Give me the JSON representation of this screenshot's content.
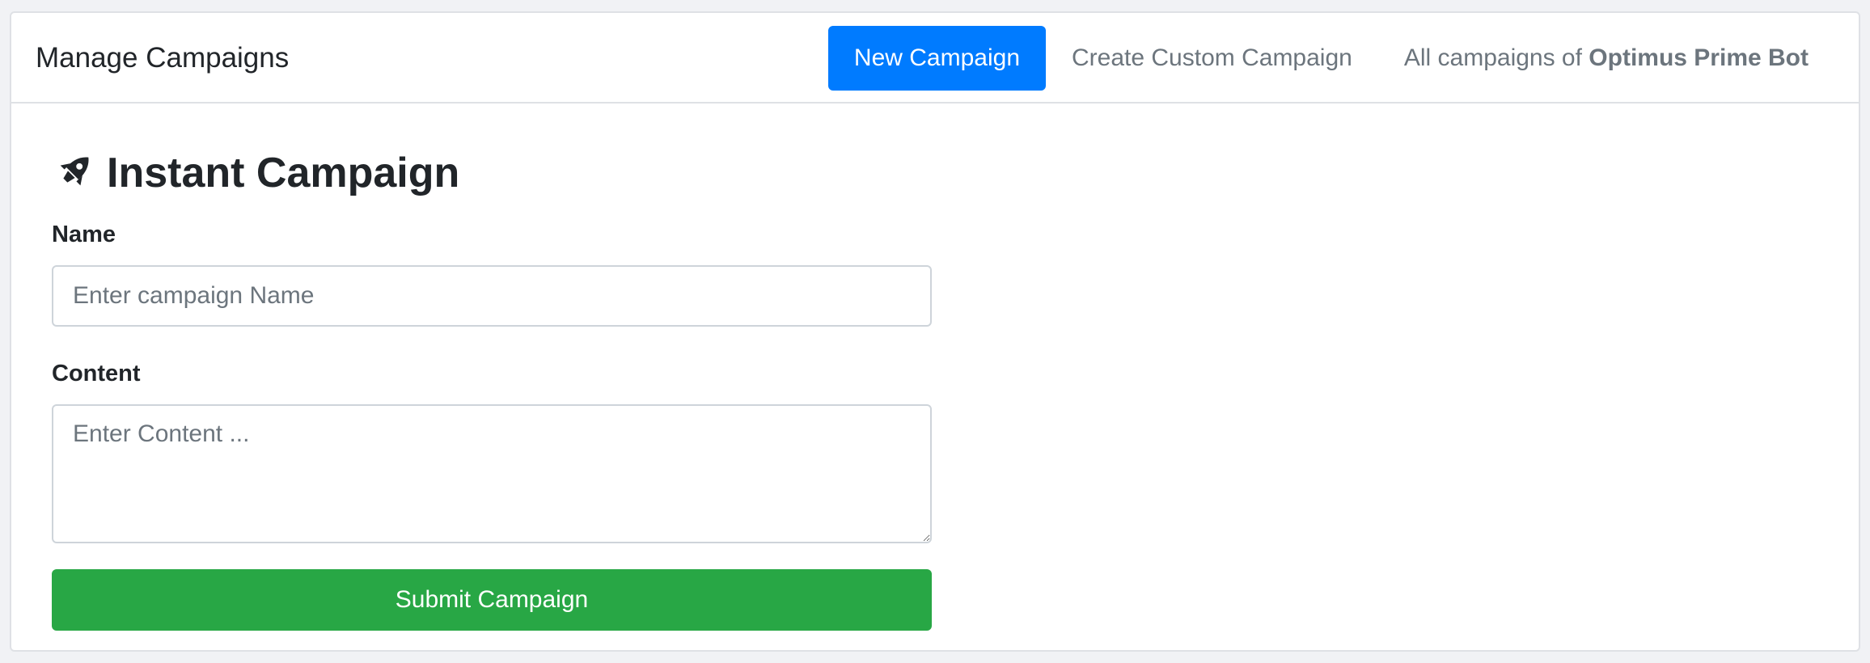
{
  "header": {
    "title": "Manage Campaigns",
    "nav": {
      "new_campaign": "New Campaign",
      "create_custom": "Create Custom Campaign",
      "all_campaigns_prefix": "All campaigns of ",
      "bot_name": "Optimus Prime Bot"
    }
  },
  "form": {
    "title": "Instant Campaign",
    "title_icon": "rocket-icon",
    "name_label": "Name",
    "name_placeholder": "Enter campaign Name",
    "name_value": "",
    "content_label": "Content",
    "content_placeholder": "Enter Content ...",
    "content_value": "",
    "submit_label": "Submit Campaign"
  },
  "colors": {
    "primary": "#007bff",
    "success": "#28a745",
    "text": "#212529",
    "muted": "#6c757d"
  }
}
